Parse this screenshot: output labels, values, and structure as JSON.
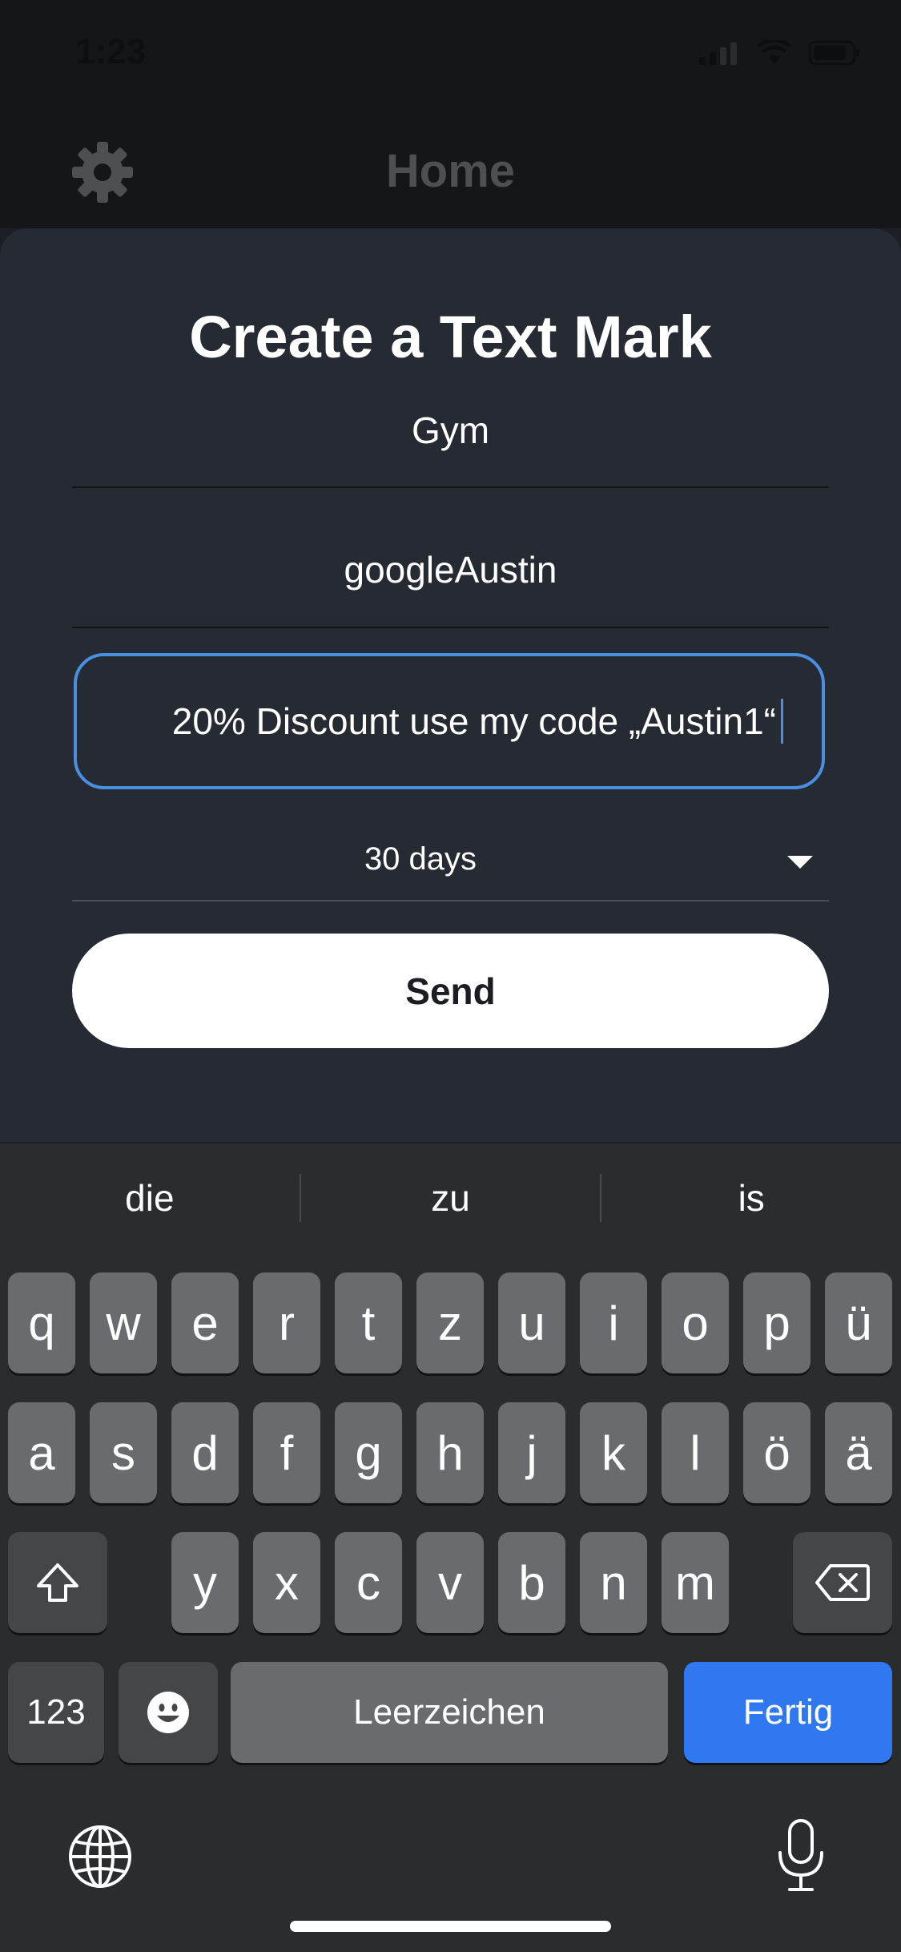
{
  "status_bar": {
    "time": "1:23"
  },
  "app_bar": {
    "title": "Home",
    "settings_icon": "gear-icon"
  },
  "form": {
    "title": "Create a Text Mark",
    "name_value": "Gym",
    "user_value": "googleAustin",
    "message_value": "20% Discount use my code „Austin1“",
    "duration_value": "30 days",
    "send_label": "Send",
    "accent_color": "#4a8fe0"
  },
  "keyboard": {
    "suggestions": [
      "die",
      "zu",
      "is"
    ],
    "row1": [
      "q",
      "w",
      "e",
      "r",
      "t",
      "z",
      "u",
      "i",
      "o",
      "p",
      "ü"
    ],
    "row2": [
      "a",
      "s",
      "d",
      "f",
      "g",
      "h",
      "j",
      "k",
      "l",
      "ö",
      "ä"
    ],
    "row3": [
      "y",
      "x",
      "c",
      "v",
      "b",
      "n",
      "m"
    ],
    "numbers_label": "123",
    "space_label": "Leerzeichen",
    "done_label": "Fertig",
    "done_color": "#2f78f0",
    "shift_icon": "shift-icon",
    "backspace_icon": "backspace-icon",
    "emoji_icon": "emoji-icon",
    "globe_icon": "globe-icon",
    "mic_icon": "microphone-icon"
  }
}
